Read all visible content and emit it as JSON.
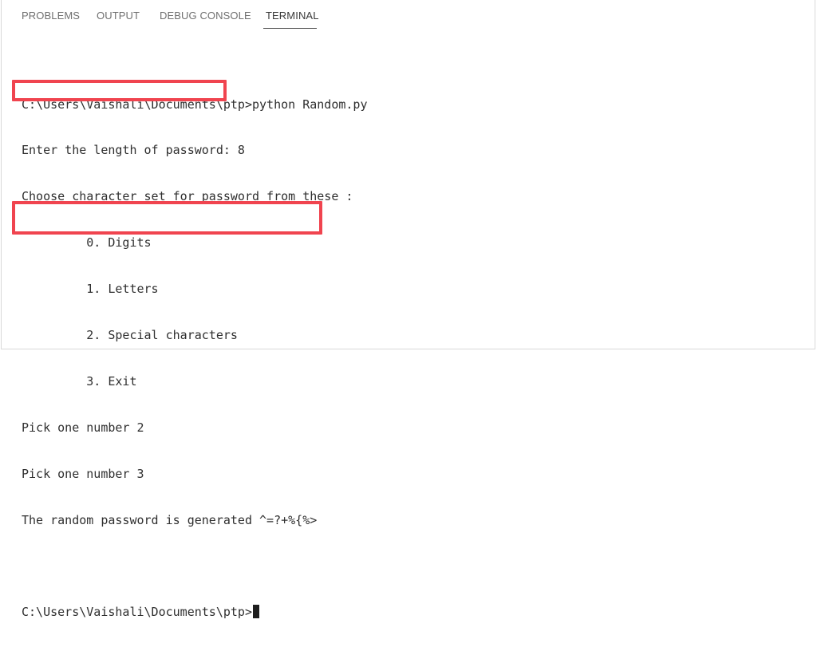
{
  "tabs": [
    {
      "label": "PROBLEMS",
      "active": false
    },
    {
      "label": "OUTPUT",
      "active": false
    },
    {
      "label": "DEBUG CONSOLE",
      "active": false
    },
    {
      "label": "TERMINAL",
      "active": true
    }
  ],
  "terminal": {
    "lines": [
      "",
      "C:\\Users\\Vaishali\\Documents\\ptp>python Random.py",
      "Enter the length of password: 8",
      "Choose character set for password from these :",
      "         0. Digits",
      "         1. Letters",
      "         2. Special characters",
      "         3. Exit",
      "Pick one number 2",
      "Pick one number 3",
      "The random password is generated ^=?+%{%>",
      "",
      "C:\\Users\\Vaishali\\Documents\\ptp>"
    ]
  },
  "colors": {
    "highlight": "#f0444f",
    "text": "#2f2f2f",
    "tab_inactive": "#707070",
    "tab_active": "#3a3a3a"
  }
}
